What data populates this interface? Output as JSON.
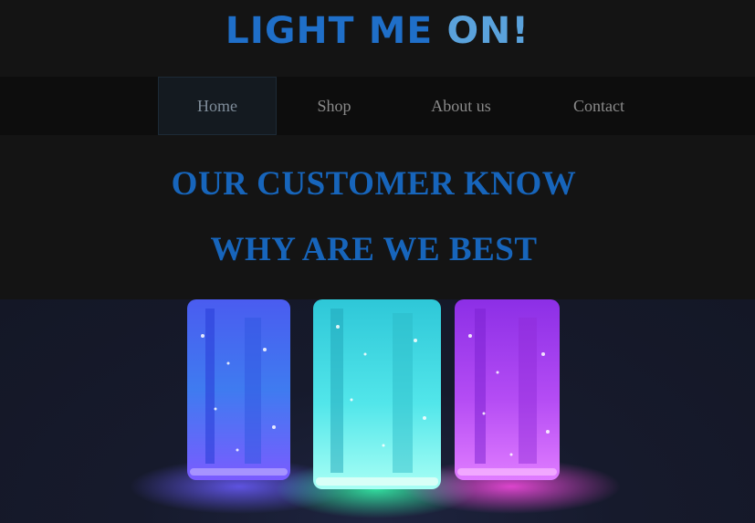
{
  "header": {
    "logo_part1": "LIGHT ME ",
    "logo_part2": "ON!"
  },
  "nav": {
    "items": [
      {
        "label": "Home",
        "active": true
      },
      {
        "label": "Shop",
        "active": false
      },
      {
        "label": "About us",
        "active": false
      },
      {
        "label": "Contact",
        "active": false
      }
    ]
  },
  "hero": {
    "line1": "OUR CUSTOMER KNOW",
    "line2": "WHY ARE WE BEST",
    "image": "three glowing jars (blue, cyan, purple)"
  },
  "colors": {
    "accent_dark": "#1f6fc9",
    "accent_light": "#5aa2dc",
    "background": "#141414",
    "nav_background": "#0d0d0d"
  }
}
